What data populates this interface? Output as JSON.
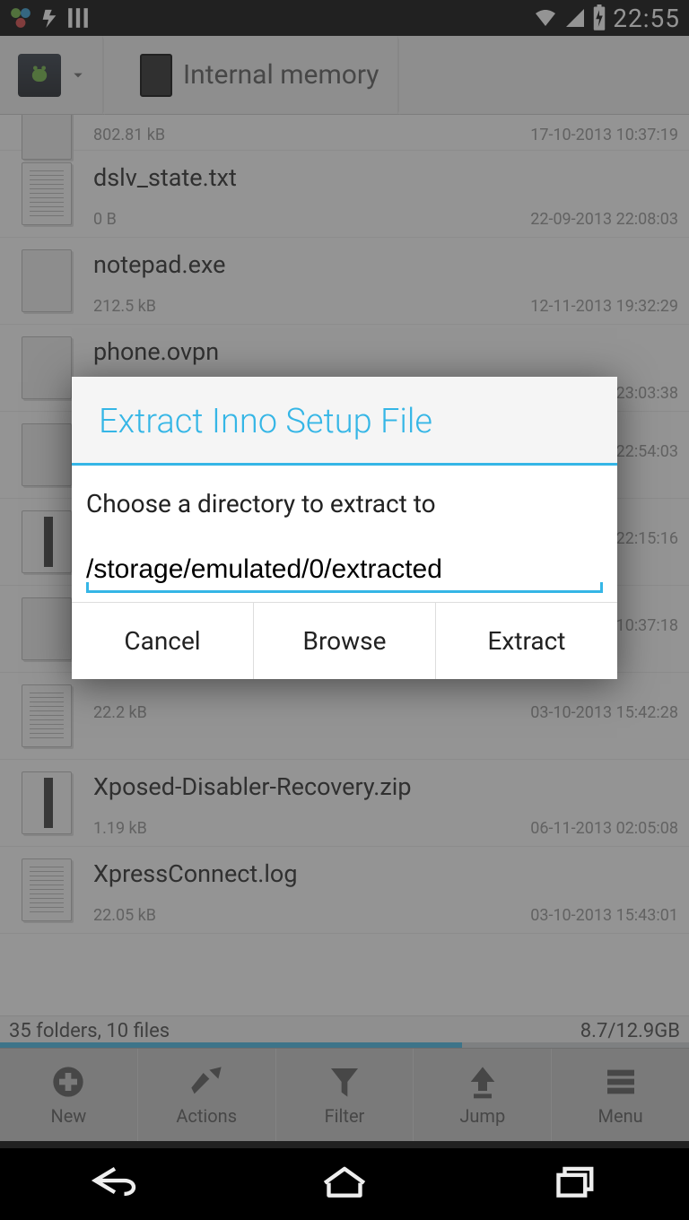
{
  "status": {
    "time": "22:55"
  },
  "breadcrumb": {
    "location": "Internal memory"
  },
  "files": [
    {
      "name": "",
      "size": "802.81 kB",
      "date": "17-10-2013 10:37:19",
      "icon": "blank"
    },
    {
      "name": "dslv_state.txt",
      "size": "0 B",
      "date": "22-09-2013 22:08:03",
      "icon": "text"
    },
    {
      "name": "notepad.exe",
      "size": "212.5 kB",
      "date": "12-11-2013 19:32:29",
      "icon": "blank"
    },
    {
      "name": "phone.ovpn",
      "size": "",
      "date": "3 23:03:38",
      "icon": "blank"
    },
    {
      "name": "",
      "size": "",
      "date": "3 22:54:03",
      "icon": "blank"
    },
    {
      "name": "",
      "size": "",
      "date": "3 22:15:16",
      "icon": "zip"
    },
    {
      "name": "",
      "size": "",
      "date": "3 10:37:18",
      "icon": "blank"
    },
    {
      "name": "",
      "size": "22.2 kB",
      "date": "03-10-2013 15:42:28",
      "icon": "text"
    },
    {
      "name": "Xposed-Disabler-Recovery.zip",
      "size": "1.19 kB",
      "date": "06-11-2013 02:05:08",
      "icon": "zip"
    },
    {
      "name": "XpressConnect.log",
      "size": "22.05 kB",
      "date": "03-10-2013 15:43:01",
      "icon": "text"
    }
  ],
  "footer": {
    "summary": "35 folders, 10 files",
    "storage": "8.7/12.9GB"
  },
  "toolbar": {
    "new": "New",
    "actions": "Actions",
    "filter": "Filter",
    "jump": "Jump",
    "menu": "Menu"
  },
  "dialog": {
    "title": "Extract Inno Setup File",
    "message": "Choose a directory to extract to",
    "path": "/storage/emulated/0/extracted",
    "cancel": "Cancel",
    "browse": "Browse",
    "extract": "Extract"
  }
}
